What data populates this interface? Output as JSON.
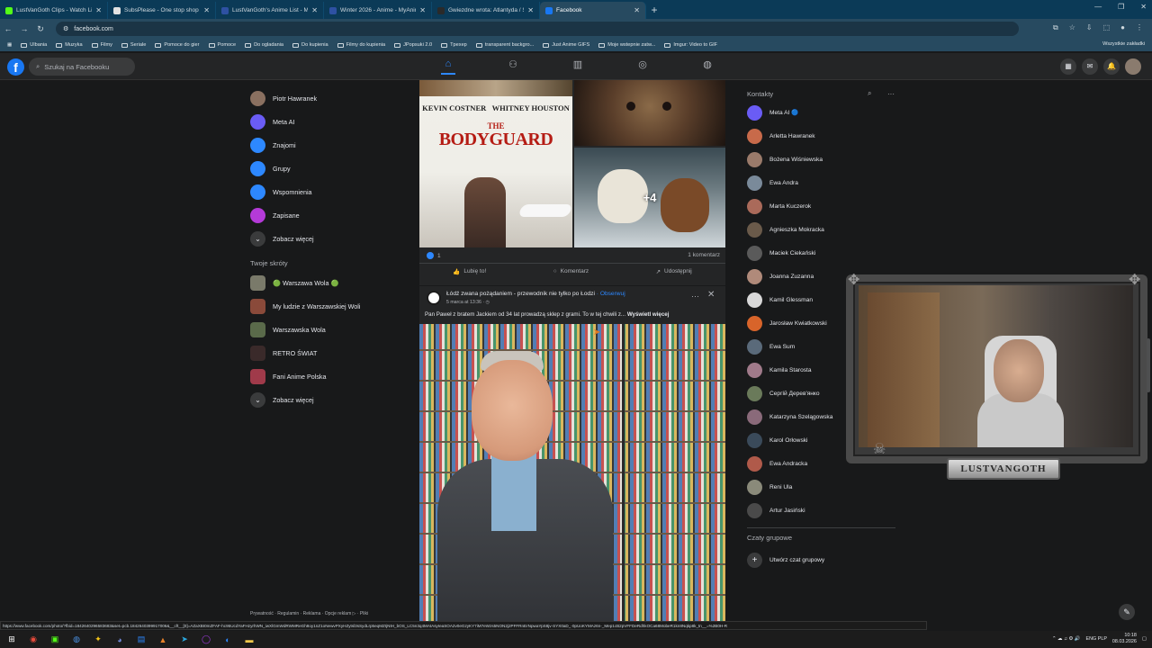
{
  "browser": {
    "tabs": [
      {
        "label": "LustVanGoth Clips - Watch Liv",
        "color": "#53fc18",
        "active": false
      },
      {
        "label": "SubsPlease - One stop shop fo",
        "color": "#e2e2e2",
        "active": false
      },
      {
        "label": "LustVanGoth's Anime List - My",
        "color": "#2e51a2",
        "active": false
      },
      {
        "label": "Winter 2026 - Anime - MyAnim",
        "color": "#2e51a2",
        "active": false
      },
      {
        "label": "Gwiezdne wrota: Atlantyda / St",
        "color": "#2a2a2a",
        "active": false
      },
      {
        "label": "Facebook",
        "color": "#1877f2",
        "active": true
      }
    ],
    "url": "facebook.com",
    "bookmarks": [
      "Ulbania",
      "Muzyka",
      "Filmy",
      "Seriale",
      "Pomoce do gier",
      "Pomoce",
      "Do ogladania",
      "Do kupienia",
      "Filmy do kupienia",
      "JPopsuki 2.0",
      "Tpexep",
      "transparent backgro...",
      "Just Anime GIFS",
      "Moje wstepnie zatw...",
      "Imgur: Video to GIF"
    ],
    "bookmarks_right": "Wszystkie zakładki"
  },
  "fb": {
    "logo": "f",
    "search_placeholder": "Szukaj na Facebooku",
    "nav": [
      "home-icon",
      "friends-icon",
      "marketplace-icon",
      "groups-icon",
      "gaming-icon"
    ]
  },
  "left_nav": {
    "items": [
      {
        "label": "Piotr Hawranek",
        "icon": "avatar",
        "color": "#8a7060"
      },
      {
        "label": "Meta AI",
        "icon": "meta-ai-icon",
        "color": "#6a5cf5"
      },
      {
        "label": "Znajomi",
        "icon": "friends-icon",
        "color": "#2d88ff"
      },
      {
        "label": "Grupy",
        "icon": "groups-icon",
        "color": "#2d88ff"
      },
      {
        "label": "Wspomnienia",
        "icon": "memories-icon",
        "color": "#2d88ff"
      },
      {
        "label": "Zapisane",
        "icon": "saved-icon",
        "color": "#b43ad8"
      },
      {
        "label": "Zobacz więcej",
        "icon": "chevron-down-icon",
        "color": "#3a3b3c"
      }
    ],
    "shortcuts_title": "Twoje skróty",
    "shortcuts": [
      {
        "label": "🟢 Warszawa Wola 🟢",
        "color": "#7a7a6a"
      },
      {
        "label": "My ludzie z Warszawskiej Woli",
        "color": "#8a4a3a"
      },
      {
        "label": "Warszawska Wola",
        "color": "#5a6a4a"
      },
      {
        "label": "RETRO ŚWIAT",
        "color": "#3a2a2a"
      },
      {
        "label": "Fani Anime Polska",
        "color": "#a03a4a"
      },
      {
        "label": "Zobacz więcej",
        "color": "#3a3b3c"
      }
    ],
    "footer": "Prywatność · Regulamin · Reklama · Opcje reklam ▷ · Pliki"
  },
  "post1": {
    "poster_names": [
      "KEVIN COSTNER",
      "WHITNEY HOUSTON"
    ],
    "poster_small": "THE",
    "poster_title": "BODYGUARD",
    "more_photos": "+4",
    "reactions_count": "1",
    "comments": "1 komentarz",
    "actions": [
      "Lubię to!",
      "Komentarz",
      "Udostępnij"
    ]
  },
  "post2": {
    "title": "Łódź zwana pożądaniem - przewodnik nie tylko po Łodzi",
    "follow": "· Obserwuj",
    "date": "5 marca at 13:36 · ◷",
    "text": "Pan Paweł z bratem Jackiem od 34 lat prowadzą sklep z grami. To w tej chwili z...",
    "see_more": "Wyświetl więcej"
  },
  "contacts": {
    "title": "Kontakty",
    "list": [
      {
        "name": "Meta AI 🔵",
        "color": "#6a5cf5",
        "online": false
      },
      {
        "name": "Arletta Hawranek",
        "color": "#c86a4a",
        "online": false
      },
      {
        "name": "Bożena Wiśniewska",
        "color": "#9a7a6a",
        "online": false
      },
      {
        "name": "Ewa Andra",
        "color": "#7a8a9a",
        "online": false
      },
      {
        "name": "Marta Kuczerok",
        "color": "#aa6a5a",
        "online": false
      },
      {
        "name": "Agnieszka Mokracka",
        "color": "#6a5a4a",
        "online": false
      },
      {
        "name": "Maciek Ciekański",
        "color": "#5a5a5a",
        "online": false
      },
      {
        "name": "Joanna Zuzanna",
        "color": "#b08a7a",
        "online": false
      },
      {
        "name": "Kamil Glessman",
        "color": "#d8d8d8",
        "online": false
      },
      {
        "name": "Jarosław Kwiatkowski",
        "color": "#d8642a",
        "online": false
      },
      {
        "name": "Ewa Sum",
        "color": "#5a6a7a",
        "online": false
      },
      {
        "name": "Kamila Starosta",
        "color": "#a07a8a",
        "online": false
      },
      {
        "name": "Сергій Дерев'янко",
        "color": "#6a7a5a",
        "online": false
      },
      {
        "name": "Katarzyna Szelągowska",
        "color": "#8a6a7a",
        "online": false
      },
      {
        "name": "Karol Orłowski",
        "color": "#3a4a5a",
        "online": false
      },
      {
        "name": "Ewa Andracka",
        "color": "#b05a4a",
        "online": false
      },
      {
        "name": "Reni Ula",
        "color": "#8a8a7a",
        "online": false
      },
      {
        "name": "Artur Jasiński",
        "color": "#4a4a4a",
        "online": false
      }
    ],
    "group_title": "Czaty grupowe",
    "create_group": "Utwórz czat grupowy"
  },
  "webcam": {
    "logo": "LUSTVANGOTH"
  },
  "status_url": "https://www.facebook.com/photo/?fbid=1842640296583683&set=pcb.1842640399917006&__cft__[0]=AZaXBI0mZFAF-hc95UcdYaFHzyrhWN_iwXlGmWdRWMReGh8oy1nZ1oNewvPXyHZytsl3sSydLrp5eqMZIjNtH_bOS_LC5n3q4MAtAsyIeaSOA2v0eGzyKY7iM7eWzs5NON2j2PFFRnErNpwaYpS8jv-SYX0aD_-0pUoKYMAz6n-_Mep1cB2pVFFDeRdhkOCa68MobeR1kn8Nqkp8k_tn__=%2B0H-R",
  "taskbar": {
    "lang": "ENG PLP",
    "time": "10:18",
    "date": "08.03.2026"
  }
}
